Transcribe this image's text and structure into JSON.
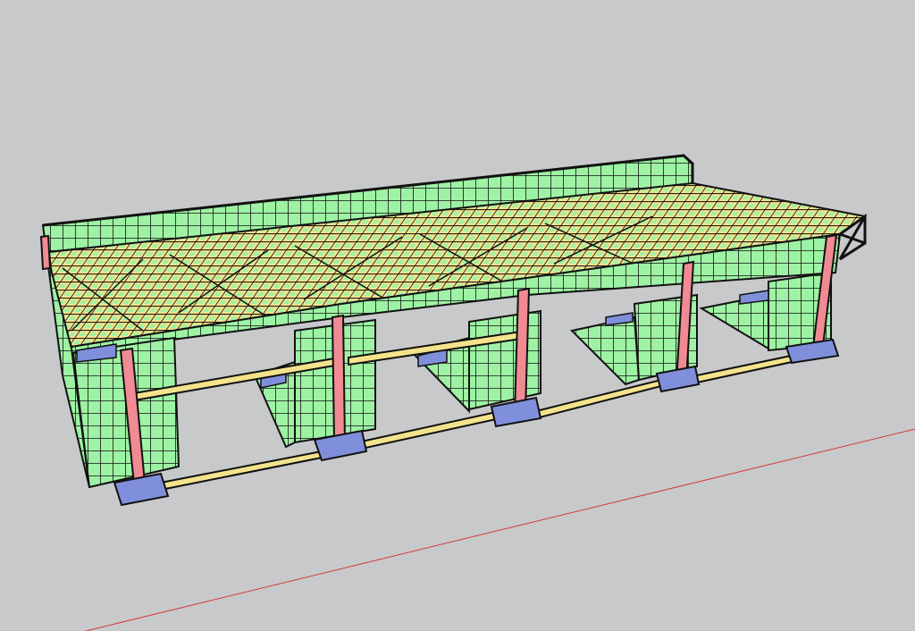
{
  "viewport": {
    "background": "#c8c9cb",
    "axis_color": "#d43a3a"
  },
  "materials": {
    "wall_panel": "#9ef2a4",
    "beam": "#f3e38c",
    "column": "#f08a93",
    "footing": "#7f8fdc",
    "edge": "#111111"
  },
  "structure": {
    "bays": 5,
    "columns_front": 6
  }
}
